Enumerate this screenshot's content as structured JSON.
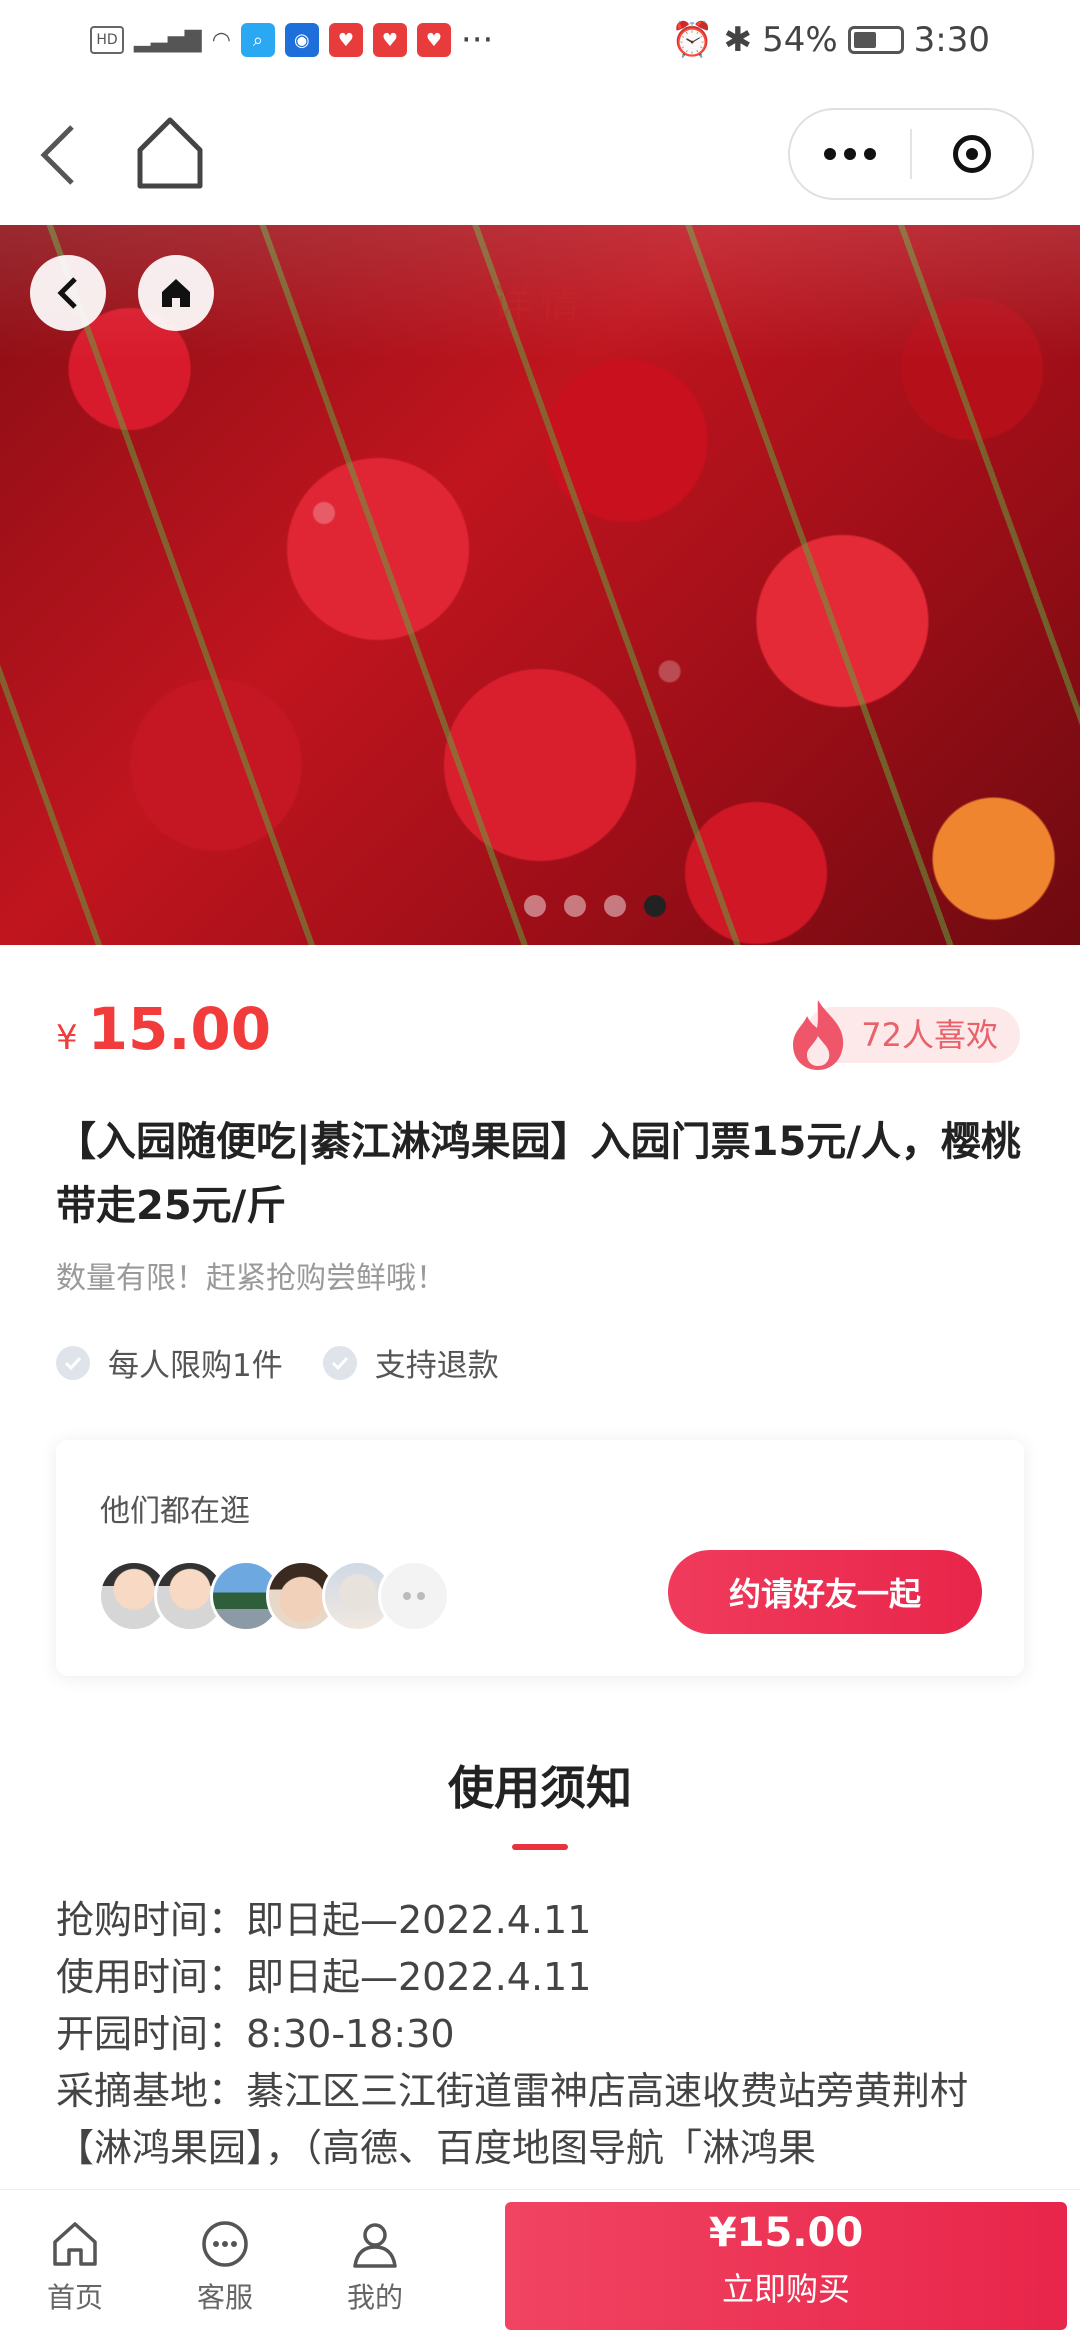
{
  "status_bar": {
    "battery": "54%",
    "time": "3:30",
    "more": "···"
  },
  "hero": {
    "overlay_title": "详情",
    "slide_count": 4,
    "active_slide": 4
  },
  "product": {
    "currency": "¥",
    "price": "15.00",
    "likes": "72人喜欢",
    "title": "【入园随便吃|綦江淋鸿果园】入园门票15元/人，樱桃带走25元/斤",
    "subtitle": "数量有限！赶紧抢购尝鲜哦！",
    "tags": [
      "每人限购1件",
      "支持退款"
    ]
  },
  "social_card": {
    "title": "他们都在逛",
    "invite_button": "约请好友一起"
  },
  "notice": {
    "heading": "使用须知",
    "lines": [
      "抢购时间：即日起—2022.4.11",
      "使用时间：即日起—2022.4.11",
      "开园时间：8:30-18:30",
      "采摘基地：綦江区三江街道雷神店高速收费站旁黄荆村【淋鸿果园】，（高德、百度地图导航「淋鸿果"
    ]
  },
  "bottom_bar": {
    "home": "首页",
    "service": "客服",
    "mine": "我的",
    "buy_price": "¥15.00",
    "buy_label": "立即购买"
  },
  "colors": {
    "accent": "#f23c3c",
    "button": "#e8254a"
  }
}
